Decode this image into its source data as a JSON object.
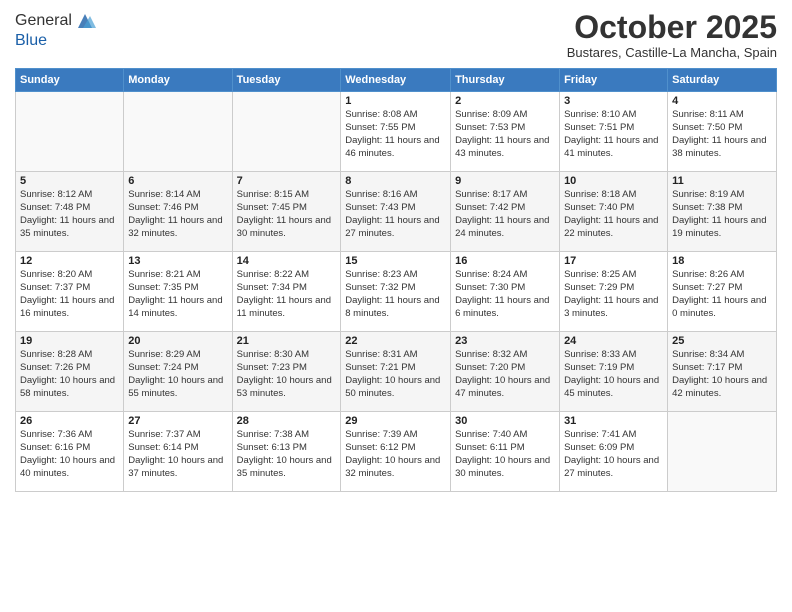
{
  "header": {
    "logo_line1": "General",
    "logo_line2": "Blue",
    "month": "October 2025",
    "location": "Bustares, Castille-La Mancha, Spain"
  },
  "weekdays": [
    "Sunday",
    "Monday",
    "Tuesday",
    "Wednesday",
    "Thursday",
    "Friday",
    "Saturday"
  ],
  "weeks": [
    [
      {
        "day": "",
        "info": ""
      },
      {
        "day": "",
        "info": ""
      },
      {
        "day": "",
        "info": ""
      },
      {
        "day": "1",
        "info": "Sunrise: 8:08 AM\nSunset: 7:55 PM\nDaylight: 11 hours and 46 minutes."
      },
      {
        "day": "2",
        "info": "Sunrise: 8:09 AM\nSunset: 7:53 PM\nDaylight: 11 hours and 43 minutes."
      },
      {
        "day": "3",
        "info": "Sunrise: 8:10 AM\nSunset: 7:51 PM\nDaylight: 11 hours and 41 minutes."
      },
      {
        "day": "4",
        "info": "Sunrise: 8:11 AM\nSunset: 7:50 PM\nDaylight: 11 hours and 38 minutes."
      }
    ],
    [
      {
        "day": "5",
        "info": "Sunrise: 8:12 AM\nSunset: 7:48 PM\nDaylight: 11 hours and 35 minutes."
      },
      {
        "day": "6",
        "info": "Sunrise: 8:14 AM\nSunset: 7:46 PM\nDaylight: 11 hours and 32 minutes."
      },
      {
        "day": "7",
        "info": "Sunrise: 8:15 AM\nSunset: 7:45 PM\nDaylight: 11 hours and 30 minutes."
      },
      {
        "day": "8",
        "info": "Sunrise: 8:16 AM\nSunset: 7:43 PM\nDaylight: 11 hours and 27 minutes."
      },
      {
        "day": "9",
        "info": "Sunrise: 8:17 AM\nSunset: 7:42 PM\nDaylight: 11 hours and 24 minutes."
      },
      {
        "day": "10",
        "info": "Sunrise: 8:18 AM\nSunset: 7:40 PM\nDaylight: 11 hours and 22 minutes."
      },
      {
        "day": "11",
        "info": "Sunrise: 8:19 AM\nSunset: 7:38 PM\nDaylight: 11 hours and 19 minutes."
      }
    ],
    [
      {
        "day": "12",
        "info": "Sunrise: 8:20 AM\nSunset: 7:37 PM\nDaylight: 11 hours and 16 minutes."
      },
      {
        "day": "13",
        "info": "Sunrise: 8:21 AM\nSunset: 7:35 PM\nDaylight: 11 hours and 14 minutes."
      },
      {
        "day": "14",
        "info": "Sunrise: 8:22 AM\nSunset: 7:34 PM\nDaylight: 11 hours and 11 minutes."
      },
      {
        "day": "15",
        "info": "Sunrise: 8:23 AM\nSunset: 7:32 PM\nDaylight: 11 hours and 8 minutes."
      },
      {
        "day": "16",
        "info": "Sunrise: 8:24 AM\nSunset: 7:30 PM\nDaylight: 11 hours and 6 minutes."
      },
      {
        "day": "17",
        "info": "Sunrise: 8:25 AM\nSunset: 7:29 PM\nDaylight: 11 hours and 3 minutes."
      },
      {
        "day": "18",
        "info": "Sunrise: 8:26 AM\nSunset: 7:27 PM\nDaylight: 11 hours and 0 minutes."
      }
    ],
    [
      {
        "day": "19",
        "info": "Sunrise: 8:28 AM\nSunset: 7:26 PM\nDaylight: 10 hours and 58 minutes."
      },
      {
        "day": "20",
        "info": "Sunrise: 8:29 AM\nSunset: 7:24 PM\nDaylight: 10 hours and 55 minutes."
      },
      {
        "day": "21",
        "info": "Sunrise: 8:30 AM\nSunset: 7:23 PM\nDaylight: 10 hours and 53 minutes."
      },
      {
        "day": "22",
        "info": "Sunrise: 8:31 AM\nSunset: 7:21 PM\nDaylight: 10 hours and 50 minutes."
      },
      {
        "day": "23",
        "info": "Sunrise: 8:32 AM\nSunset: 7:20 PM\nDaylight: 10 hours and 47 minutes."
      },
      {
        "day": "24",
        "info": "Sunrise: 8:33 AM\nSunset: 7:19 PM\nDaylight: 10 hours and 45 minutes."
      },
      {
        "day": "25",
        "info": "Sunrise: 8:34 AM\nSunset: 7:17 PM\nDaylight: 10 hours and 42 minutes."
      }
    ],
    [
      {
        "day": "26",
        "info": "Sunrise: 7:36 AM\nSunset: 6:16 PM\nDaylight: 10 hours and 40 minutes."
      },
      {
        "day": "27",
        "info": "Sunrise: 7:37 AM\nSunset: 6:14 PM\nDaylight: 10 hours and 37 minutes."
      },
      {
        "day": "28",
        "info": "Sunrise: 7:38 AM\nSunset: 6:13 PM\nDaylight: 10 hours and 35 minutes."
      },
      {
        "day": "29",
        "info": "Sunrise: 7:39 AM\nSunset: 6:12 PM\nDaylight: 10 hours and 32 minutes."
      },
      {
        "day": "30",
        "info": "Sunrise: 7:40 AM\nSunset: 6:11 PM\nDaylight: 10 hours and 30 minutes."
      },
      {
        "day": "31",
        "info": "Sunrise: 7:41 AM\nSunset: 6:09 PM\nDaylight: 10 hours and 27 minutes."
      },
      {
        "day": "",
        "info": ""
      }
    ]
  ]
}
